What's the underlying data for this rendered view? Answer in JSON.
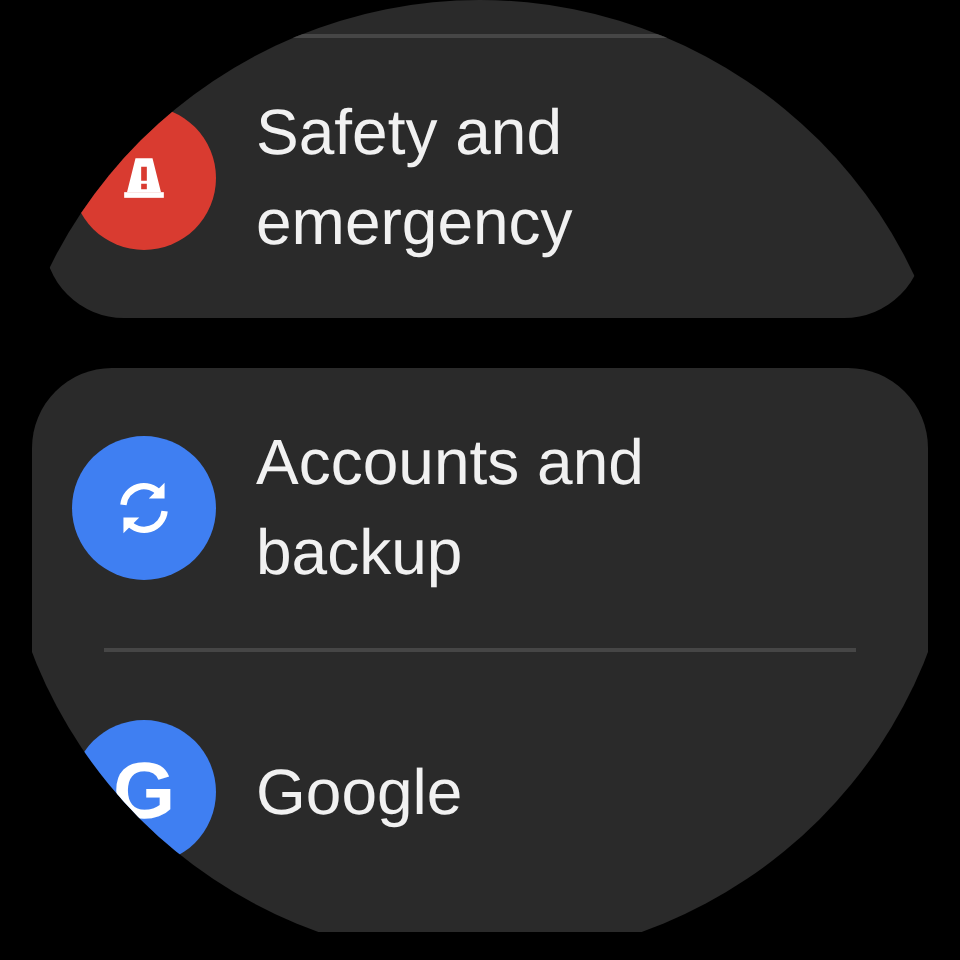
{
  "groups": [
    {
      "items": [
        {
          "kind": "safety",
          "label": "Safety and emergency",
          "color": "#d93b30"
        }
      ]
    },
    {
      "items": [
        {
          "kind": "sync",
          "label": "Accounts and backup",
          "color": "#3f7ff2"
        },
        {
          "kind": "letter",
          "label": "Google",
          "color": "#3f7ff2",
          "icon_letter": "G"
        }
      ]
    }
  ]
}
